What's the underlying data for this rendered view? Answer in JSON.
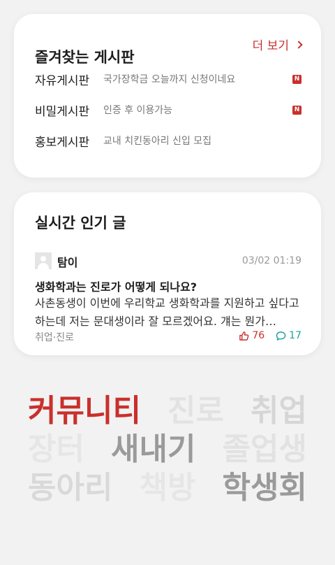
{
  "favorites": {
    "title": "즐겨찾는 게시판",
    "more_label": "더 보기",
    "boards": [
      {
        "name": "자유게시판",
        "preview": "국가장학금 오늘까지 신청이네요",
        "badge": "N"
      },
      {
        "name": "비밀게시판",
        "preview": "인증 후 이용가능",
        "badge": "N"
      },
      {
        "name": "홍보게시판",
        "preview": "교내 치킨동아리 신입 모집",
        "badge": ""
      }
    ]
  },
  "popular": {
    "title": "실시간 인기 글",
    "post": {
      "author": "탐이",
      "time": "03/02 01:19",
      "title": "생화학과는 진로가 어떻게 되나요?",
      "body": "사촌동생이 이번에 우리학교 생화학과를 지원하고 싶다고 하는데 저는 문대생이라 잘 모르겠어요. 걔는 뭔가…",
      "category": "취업·진로",
      "likes": "76",
      "comments": "17"
    }
  },
  "tags": [
    [
      {
        "text": "커뮤니티",
        "color": "#c9302c"
      },
      {
        "text": "진로",
        "color": "#e2e2e2"
      },
      {
        "text": "취업",
        "color": "#d6d6d6"
      }
    ],
    [
      {
        "text": "장터",
        "color": "#e6e6e6"
      },
      {
        "text": "새내기",
        "color": "#9a9a9a"
      },
      {
        "text": "졸업생",
        "color": "#e2e2e2"
      }
    ],
    [
      {
        "text": "동아리",
        "color": "#d9d9d9"
      },
      {
        "text": "책방",
        "color": "#e6e6e6"
      },
      {
        "text": "학생회",
        "color": "#9a9a9a"
      }
    ]
  ]
}
